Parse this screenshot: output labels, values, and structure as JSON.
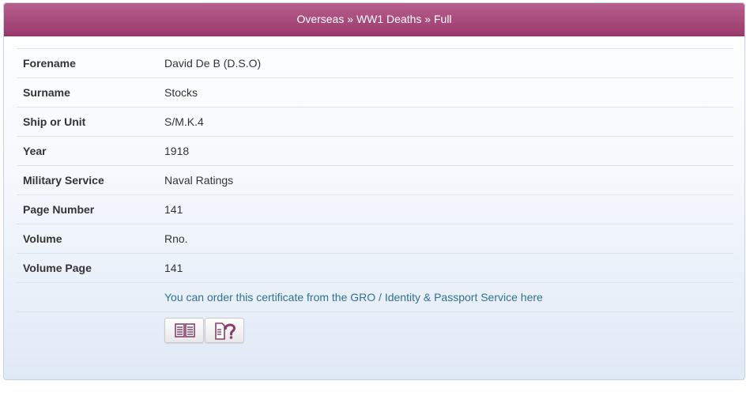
{
  "breadcrumb": {
    "items": [
      "Overseas",
      "WW1 Deaths",
      "Full"
    ],
    "separator": " » "
  },
  "record": {
    "rows": [
      {
        "label": "Forename",
        "value": "David De B (D.S.O)"
      },
      {
        "label": "Surname",
        "value": "Stocks"
      },
      {
        "label": "Ship or Unit",
        "value": "S/M.K.4"
      },
      {
        "label": "Year",
        "value": "1918"
      },
      {
        "label": "Military Service",
        "value": "Naval Ratings"
      },
      {
        "label": "Page Number",
        "value": "141"
      },
      {
        "label": "Volume",
        "value": "Rno."
      },
      {
        "label": "Volume Page",
        "value": "141"
      }
    ],
    "order_link": "You can order this certificate from the GRO / Identity & Passport Service here"
  },
  "buttons": [
    {
      "icon": "book-icon"
    },
    {
      "icon": "help-page-icon"
    }
  ],
  "colors": {
    "header": "#a9497b",
    "link": "#31708f",
    "icon": "#8c3c6a"
  }
}
